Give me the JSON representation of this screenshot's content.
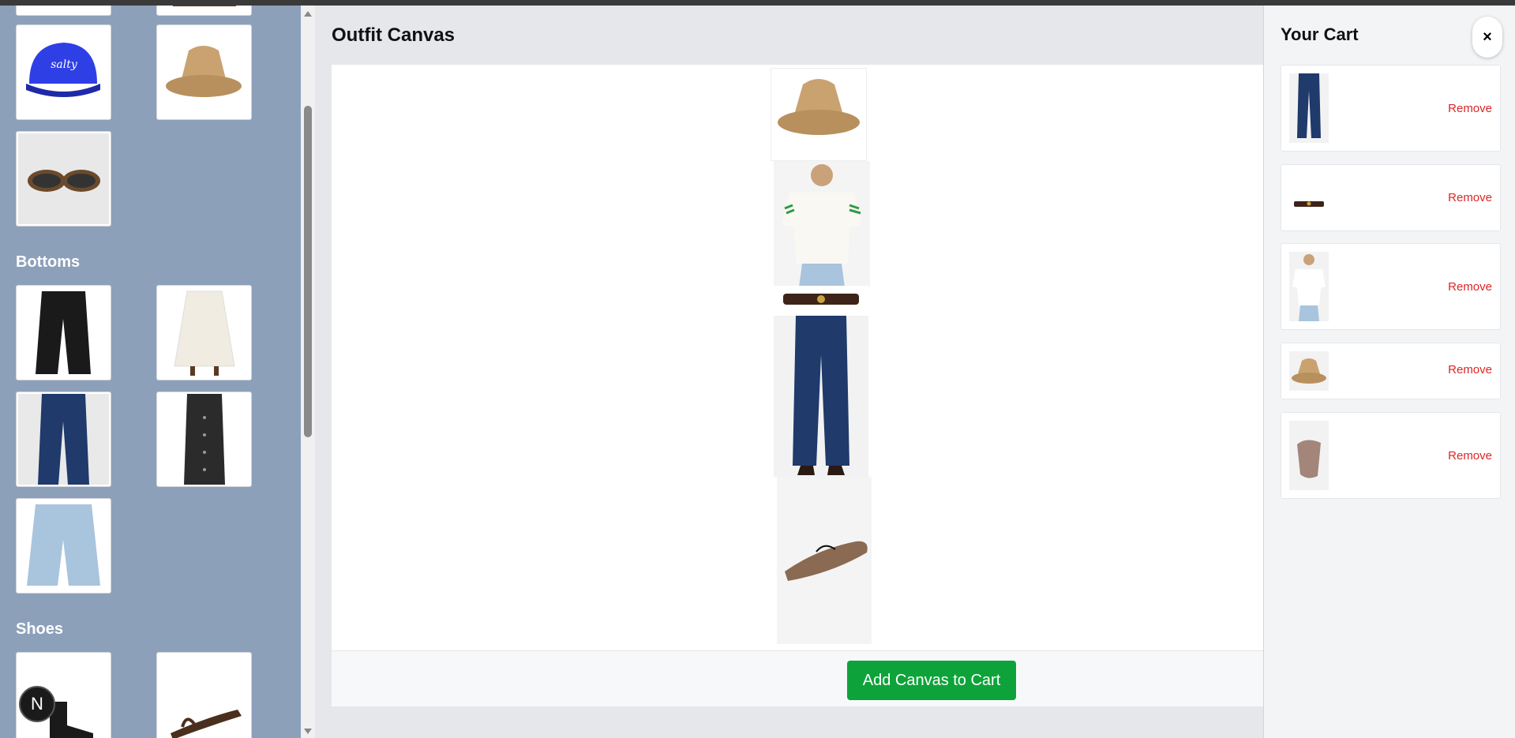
{
  "sidebar": {
    "sections": [
      {
        "title": "Bottoms"
      },
      {
        "title": "Shoes"
      }
    ],
    "accessories": [
      {
        "icon": "baseball-cap-image",
        "cap_text": "salty"
      },
      {
        "icon": "straw-hat-image"
      },
      {
        "icon": "sunglasses-image"
      }
    ],
    "bottoms": [
      {
        "icon": "black-trousers-image"
      },
      {
        "icon": "white-skirt-image"
      },
      {
        "icon": "blue-jeans-image"
      },
      {
        "icon": "black-skirt-image"
      },
      {
        "icon": "denim-shorts-image"
      }
    ],
    "shoes": [
      {
        "icon": "black-boot-image"
      },
      {
        "icon": "sandal-image"
      }
    ],
    "badge_letter": "N"
  },
  "main": {
    "title": "Outfit Canvas",
    "canvas_items": [
      {
        "icon": "straw-hat-image"
      },
      {
        "icon": "white-tshirt-image"
      },
      {
        "icon": "belt-image"
      },
      {
        "icon": "blue-jeans-image"
      },
      {
        "icon": "mesh-flat-image"
      }
    ],
    "add_button_label": "Add Canvas to Cart"
  },
  "cart": {
    "title": "Your Cart",
    "close_label": "×",
    "items": [
      {
        "icon": "blue-jeans-image",
        "remove_label": "Remove"
      },
      {
        "icon": "belt-image",
        "remove_label": "Remove"
      },
      {
        "icon": "white-tshirt-image",
        "remove_label": "Remove"
      },
      {
        "icon": "straw-hat-image",
        "remove_label": "Remove"
      },
      {
        "icon": "mesh-flat-image",
        "remove_label": "Remove"
      }
    ]
  },
  "colors": {
    "sidebar_bg": "#8da0ba",
    "accent_green": "#0ea33a",
    "remove_red": "#dc2626",
    "cap_blue": "#2f3fe6"
  }
}
